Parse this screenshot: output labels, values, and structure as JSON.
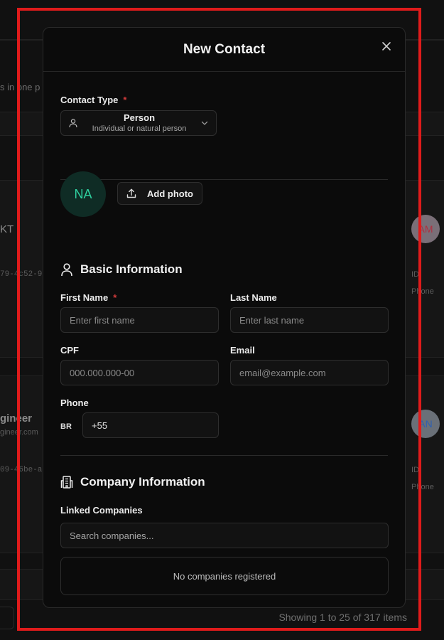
{
  "background": {
    "snippet_text": "s in one p",
    "row1": {
      "name_fragment": "KT",
      "id_fragment": "79-4c52-9",
      "avatar": "AM",
      "id_label": "ID",
      "phone_label": "Phone"
    },
    "row2": {
      "name_fragment": "gineer",
      "email_fragment": "gineer.com",
      "id_fragment": "09-46be-a",
      "avatar": "AN",
      "id_label": "ID",
      "phone_label": "Phone"
    },
    "footer": "Showing 1 to 25 of 317 items"
  },
  "modal": {
    "title": "New Contact",
    "contact_type": {
      "label": "Contact Type",
      "required_mark": "*",
      "selected_main": "Person",
      "selected_sub": "Individual or natural person"
    },
    "avatar_initials": "NA",
    "add_photo_label": "Add photo",
    "basic_info": {
      "title": "Basic Information",
      "first_name": {
        "label": "First Name",
        "required_mark": "*",
        "placeholder": "Enter first name"
      },
      "last_name": {
        "label": "Last Name",
        "placeholder": "Enter last name"
      },
      "cpf": {
        "label": "CPF",
        "placeholder": "000.000.000-00"
      },
      "email": {
        "label": "Email",
        "placeholder": "email@example.com"
      },
      "phone": {
        "label": "Phone",
        "country": "BR",
        "value": "+55"
      }
    },
    "company_info": {
      "title": "Company Information",
      "linked_label": "Linked Companies",
      "search_placeholder": "Search companies...",
      "empty_text": "No companies registered"
    }
  },
  "colors": {
    "accent_avatar_bg": "#0f2c25",
    "accent_avatar_text": "#2fd1a0",
    "required": "#d23b3b",
    "frame": "#e01b1b"
  },
  "icons": {
    "close": "close-icon",
    "person": "person-icon",
    "chevron": "chevron-down-icon",
    "upload": "upload-icon",
    "user_section": "user-icon",
    "building": "building-icon"
  }
}
